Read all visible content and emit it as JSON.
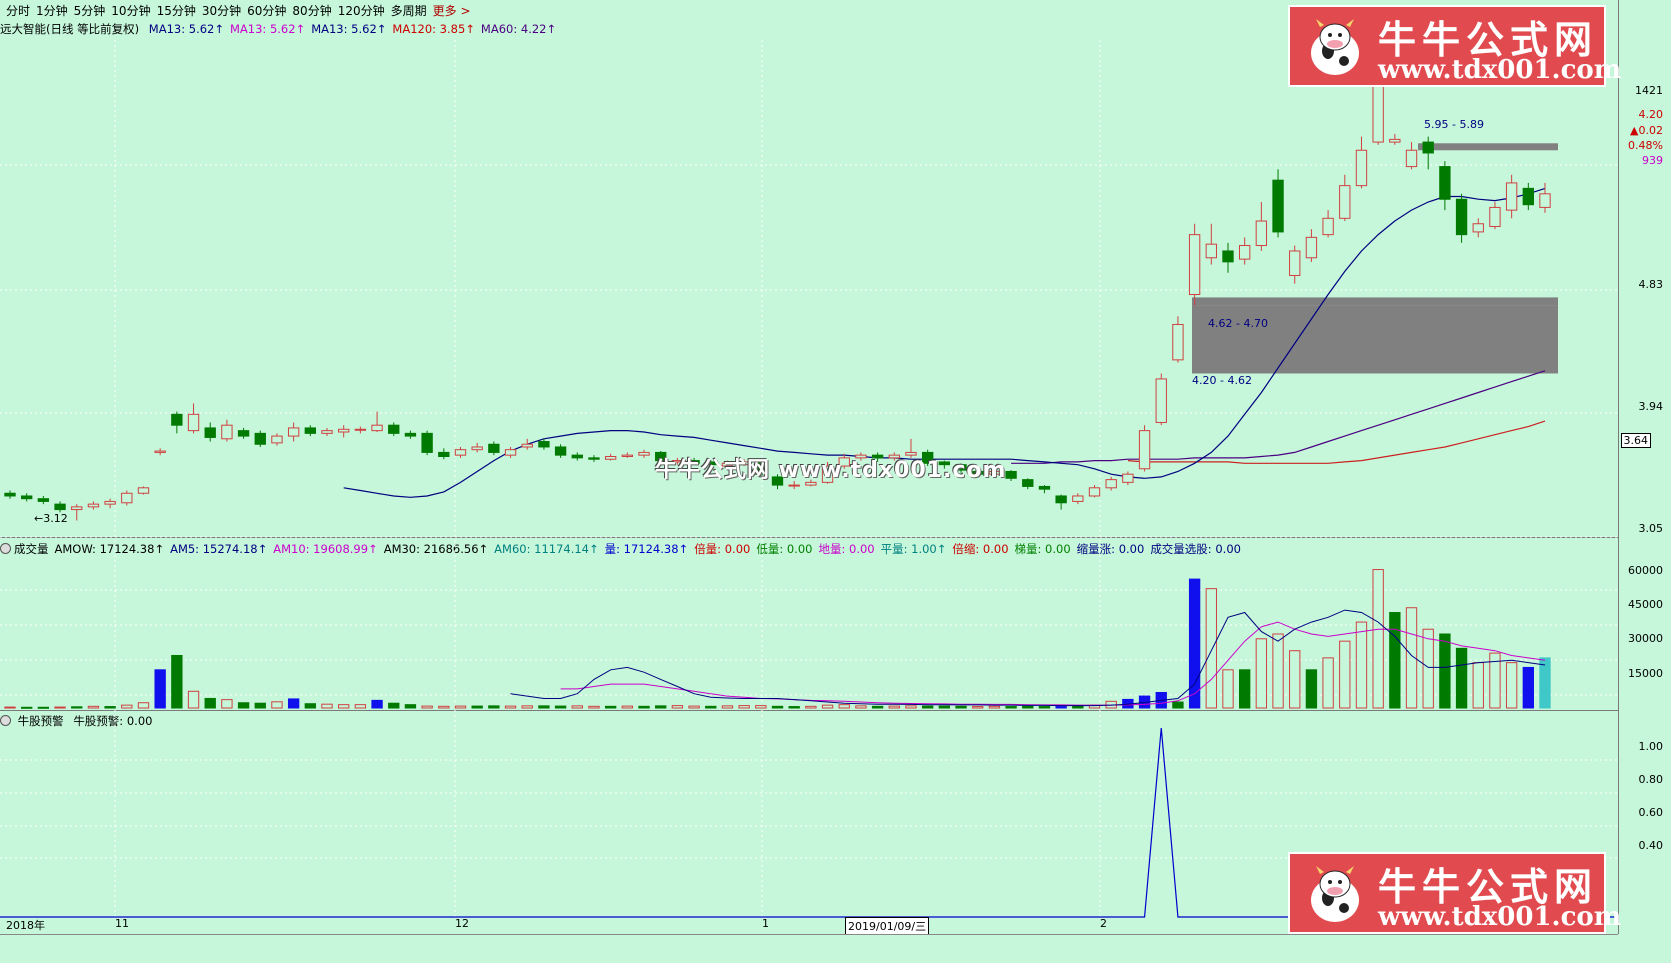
{
  "tabs": [
    "分时",
    "1分钟",
    "5分钟",
    "10分钟",
    "15分钟",
    "30分钟",
    "60分钟",
    "80分钟",
    "120分钟",
    "多周期",
    "更多 >"
  ],
  "main_legend": {
    "title": "远大智能(日线 等比前复权)",
    "items": [
      {
        "text": "MA13: 5.62↑",
        "color": "#000080"
      },
      {
        "text": "MA13: 5.62↑",
        "color": "#cc00cc"
      },
      {
        "text": "MA13: 5.62↑",
        "color": "#000080"
      },
      {
        "text": "MA120: 3.85↑",
        "color": "#cc0000"
      },
      {
        "text": "MA60: 4.22↑",
        "color": "#4b0082"
      }
    ]
  },
  "volume_legend": {
    "items": [
      {
        "text": "成交量",
        "color": "#000000"
      },
      {
        "text": "AMOW: 17124.38↑",
        "color": "#000000"
      },
      {
        "text": "AM5: 15274.18↑",
        "color": "#000080"
      },
      {
        "text": "AM10: 19608.99↑",
        "color": "#cc00cc"
      },
      {
        "text": "AM30: 21686.56↑",
        "color": "#000000"
      },
      {
        "text": "AM60: 11174.14↑",
        "color": "#008080"
      },
      {
        "text": "量: 17124.38↑",
        "color": "#0000cc"
      },
      {
        "text": "倍量: 0.00",
        "color": "#cc0000"
      },
      {
        "text": "低量: 0.00",
        "color": "#008000"
      },
      {
        "text": "地量: 0.00",
        "color": "#cc00cc"
      },
      {
        "text": "平量: 1.00↑",
        "color": "#008080"
      },
      {
        "text": "倍缩: 0.00",
        "color": "#cc0000"
      },
      {
        "text": "梯量: 0.00",
        "color": "#008000"
      },
      {
        "text": "缩量涨: 0.00",
        "color": "#000080"
      },
      {
        "text": "成交量选股: 0.00",
        "color": "#000080"
      }
    ]
  },
  "indicator_legend": {
    "title": "牛股预警",
    "value": "牛股预警: 0.00"
  },
  "price_axis": [
    "1421",
    "4.20",
    "▲0.02",
    "0.48%",
    "939",
    "4.83",
    "3.94",
    "3.64",
    "3.05"
  ],
  "volume_axis": [
    "60000",
    "45000",
    "30000",
    "15000"
  ],
  "indicator_axis": [
    "1.00",
    "0.80",
    "0.60",
    "0.40"
  ],
  "annotations": {
    "low_label": "←3.12",
    "zone_label_1": "4.62 - 4.70",
    "zone_label_2": "4.20 - 4.62",
    "high_zone_label": "5.95 - 5.89"
  },
  "date_labels": [
    "2018年",
    "11",
    "12",
    "1",
    "2019/01/09/三",
    "2"
  ],
  "watermark": {
    "logo_text": "牛牛公式网",
    "logo_url": "www.tdx001.com",
    "center_text": "牛牛公式网 www.tdx001.com"
  },
  "colors": {
    "background": "#c6f7da",
    "up": "#d04040",
    "down": "#007a00",
    "ma_dark": "#000080",
    "ma60": "#4b0082",
    "ma120": "#cc2020"
  },
  "chart_data": {
    "type": "candlestick",
    "candles": [
      [
        3.32,
        3.3,
        3.34,
        3.28
      ],
      [
        3.3,
        3.28,
        3.32,
        3.26
      ],
      [
        3.28,
        3.26,
        3.3,
        3.24
      ],
      [
        3.24,
        3.2,
        3.26,
        3.18
      ],
      [
        3.2,
        3.22,
        3.24,
        3.12
      ],
      [
        3.22,
        3.24,
        3.26,
        3.2
      ],
      [
        3.24,
        3.26,
        3.28,
        3.21
      ],
      [
        3.25,
        3.32,
        3.34,
        3.23
      ],
      [
        3.32,
        3.36,
        3.37,
        3.31
      ],
      [
        3.62,
        3.63,
        3.65,
        3.6
      ],
      [
        3.9,
        3.82,
        3.92,
        3.76
      ],
      [
        3.78,
        3.9,
        3.98,
        3.76
      ],
      [
        3.8,
        3.73,
        3.84,
        3.7
      ],
      [
        3.72,
        3.82,
        3.86,
        3.7
      ],
      [
        3.78,
        3.74,
        3.8,
        3.72
      ],
      [
        3.76,
        3.68,
        3.78,
        3.66
      ],
      [
        3.69,
        3.74,
        3.76,
        3.67
      ],
      [
        3.74,
        3.8,
        3.84,
        3.7
      ],
      [
        3.8,
        3.76,
        3.82,
        3.74
      ],
      [
        3.76,
        3.78,
        3.8,
        3.74
      ],
      [
        3.77,
        3.79,
        3.82,
        3.73
      ],
      [
        3.79,
        3.79,
        3.81,
        3.76
      ],
      [
        3.78,
        3.82,
        3.92,
        3.77
      ],
      [
        3.82,
        3.76,
        3.84,
        3.74
      ],
      [
        3.76,
        3.74,
        3.78,
        3.72
      ],
      [
        3.76,
        3.62,
        3.78,
        3.6
      ],
      [
        3.62,
        3.59,
        3.65,
        3.57
      ],
      [
        3.6,
        3.64,
        3.66,
        3.58
      ],
      [
        3.64,
        3.66,
        3.69,
        3.62
      ],
      [
        3.68,
        3.62,
        3.7,
        3.6
      ],
      [
        3.6,
        3.64,
        3.66,
        3.58
      ],
      [
        3.66,
        3.68,
        3.72,
        3.64
      ],
      [
        3.7,
        3.66,
        3.72,
        3.64
      ],
      [
        3.66,
        3.6,
        3.68,
        3.58
      ],
      [
        3.6,
        3.58,
        3.62,
        3.56
      ],
      [
        3.58,
        3.57,
        3.6,
        3.55
      ],
      [
        3.57,
        3.59,
        3.61,
        3.56
      ],
      [
        3.59,
        3.6,
        3.62,
        3.58
      ],
      [
        3.6,
        3.62,
        3.64,
        3.58
      ],
      [
        3.62,
        3.56,
        3.63,
        3.53
      ],
      [
        3.55,
        3.56,
        3.58,
        3.53
      ],
      [
        3.56,
        3.54,
        3.58,
        3.53
      ],
      [
        3.55,
        3.53,
        3.56,
        3.5
      ],
      [
        3.52,
        3.54,
        3.56,
        3.51
      ],
      [
        3.53,
        3.55,
        3.57,
        3.52
      ],
      [
        3.55,
        3.46,
        3.56,
        3.44
      ],
      [
        3.44,
        3.38,
        3.46,
        3.35
      ],
      [
        3.38,
        3.38,
        3.41,
        3.35
      ],
      [
        3.38,
        3.4,
        3.42,
        3.37
      ],
      [
        3.4,
        3.52,
        3.55,
        3.39
      ],
      [
        3.52,
        3.58,
        3.61,
        3.5
      ],
      [
        3.58,
        3.6,
        3.62,
        3.56
      ],
      [
        3.6,
        3.58,
        3.62,
        3.55
      ],
      [
        3.58,
        3.6,
        3.62,
        3.56
      ],
      [
        3.6,
        3.62,
        3.72,
        3.58
      ],
      [
        3.62,
        3.54,
        3.64,
        3.52
      ],
      [
        3.55,
        3.53,
        3.56,
        3.5
      ],
      [
        3.53,
        3.49,
        3.54,
        3.47
      ],
      [
        3.48,
        3.46,
        3.5,
        3.45
      ],
      [
        3.46,
        3.48,
        3.5,
        3.45
      ],
      [
        3.48,
        3.43,
        3.49,
        3.41
      ],
      [
        3.42,
        3.37,
        3.43,
        3.35
      ],
      [
        3.37,
        3.35,
        3.38,
        3.32
      ],
      [
        3.3,
        3.25,
        3.31,
        3.2
      ],
      [
        3.26,
        3.3,
        3.32,
        3.24
      ],
      [
        3.3,
        3.36,
        3.38,
        3.29
      ],
      [
        3.36,
        3.42,
        3.44,
        3.34
      ],
      [
        3.4,
        3.46,
        3.48,
        3.38
      ],
      [
        3.5,
        3.78,
        3.82,
        3.48
      ],
      [
        3.84,
        4.16,
        4.2,
        3.82
      ],
      [
        4.3,
        4.56,
        4.62,
        4.28
      ],
      [
        4.78,
        5.22,
        5.3,
        4.7
      ],
      [
        5.05,
        5.15,
        5.3,
        5.0
      ],
      [
        5.1,
        5.02,
        5.16,
        4.94
      ],
      [
        5.04,
        5.14,
        5.2,
        5.0
      ],
      [
        5.14,
        5.32,
        5.46,
        5.1
      ],
      [
        5.62,
        5.24,
        5.7,
        5.2
      ],
      [
        4.92,
        5.1,
        5.14,
        4.86
      ],
      [
        5.05,
        5.2,
        5.26,
        5.02
      ],
      [
        5.22,
        5.34,
        5.4,
        5.2
      ],
      [
        5.34,
        5.58,
        5.66,
        5.32
      ],
      [
        5.58,
        5.84,
        5.94,
        5.56
      ],
      [
        5.9,
        6.5,
        6.6,
        5.88
      ],
      [
        5.9,
        5.92,
        5.96,
        5.88
      ],
      [
        5.72,
        5.84,
        5.9,
        5.7
      ],
      [
        5.9,
        5.82,
        5.94,
        5.7
      ],
      [
        5.72,
        5.48,
        5.76,
        5.4
      ],
      [
        5.48,
        5.22,
        5.52,
        5.16
      ],
      [
        5.24,
        5.3,
        5.34,
        5.2
      ],
      [
        5.28,
        5.42,
        5.46,
        5.26
      ],
      [
        5.4,
        5.6,
        5.66,
        5.34
      ],
      [
        5.56,
        5.44,
        5.6,
        5.4
      ],
      [
        5.42,
        5.52,
        5.6,
        5.38
      ]
    ],
    "ma13": [
      3.36,
      3.34,
      3.32,
      3.3,
      3.29,
      3.3,
      3.33,
      3.4,
      3.48,
      3.56,
      3.63,
      3.68,
      3.72,
      3.74,
      3.76,
      3.77,
      3.78,
      3.78,
      3.77,
      3.75,
      3.74,
      3.73,
      3.71,
      3.69,
      3.67,
      3.65,
      3.63,
      3.62,
      3.61,
      3.6,
      3.6,
      3.59,
      3.58,
      3.58,
      3.57,
      3.57,
      3.57,
      3.57,
      3.57,
      3.57,
      3.57,
      3.56,
      3.55,
      3.54,
      3.53,
      3.5,
      3.46,
      3.44,
      3.43,
      3.44,
      3.48,
      3.54,
      3.62,
      3.74,
      3.9,
      4.06,
      4.24,
      4.42,
      4.6,
      4.78,
      4.95,
      5.1,
      5.22,
      5.32,
      5.4,
      5.46,
      5.5,
      5.5,
      5.48,
      5.47,
      5.49,
      5.52,
      5.56
    ],
    "ma60": [
      3.54,
      3.54,
      3.54,
      3.55,
      3.55,
      3.56,
      3.56,
      3.57,
      3.57,
      3.57,
      3.57,
      3.58,
      3.58,
      3.58,
      3.58,
      3.59,
      3.6,
      3.62,
      3.66,
      3.7,
      3.74,
      3.78,
      3.82,
      3.86,
      3.9,
      3.94,
      3.98,
      4.02,
      4.06,
      4.1,
      4.14,
      4.18,
      4.22
    ],
    "ma120": [
      3.56,
      3.55,
      3.55,
      3.55,
      3.55,
      3.55,
      3.55,
      3.54,
      3.54,
      3.54,
      3.54,
      3.54,
      3.54,
      3.55,
      3.56,
      3.58,
      3.6,
      3.62,
      3.64,
      3.66,
      3.69,
      3.72,
      3.75,
      3.78,
      3.81,
      3.85
    ],
    "volumes": [
      400,
      300,
      300,
      400,
      500,
      700,
      600,
      1200,
      2200,
      16000,
      22000,
      7000,
      4000,
      3500,
      2200,
      2000,
      2600,
      3800,
      1800,
      1600,
      1400,
      1400,
      3200,
      2000,
      1400,
      800,
      700,
      800,
      800,
      900,
      800,
      900,
      900,
      800,
      900,
      700,
      700,
      800,
      700,
      900,
      1000,
      800,
      700,
      900,
      1000,
      1000,
      700,
      600,
      700,
      1200,
      1400,
      900,
      700,
      800,
      900,
      800,
      800,
      700,
      600,
      700,
      600,
      700,
      600,
      600,
      800,
      1200,
      2800,
      3600,
      5000,
      6500,
      2500,
      54000,
      50000,
      16000,
      16000,
      29000,
      31000,
      24000,
      16000,
      21000,
      28000,
      36000,
      58000,
      40000,
      42000,
      33000,
      31000,
      25000,
      19000,
      23000,
      19000,
      17000,
      21000
    ],
    "volume_colors": [
      "up",
      "down",
      "down",
      "up",
      "down",
      "up",
      "down",
      "up",
      "up",
      "blue",
      "down",
      "up",
      "down",
      "up",
      "down",
      "down",
      "up",
      "blue",
      "down",
      "up",
      "up",
      "up",
      "blue",
      "down",
      "down",
      "up",
      "up",
      "up",
      "down",
      "down",
      "up",
      "up",
      "down",
      "down",
      "up",
      "up",
      "down",
      "up",
      "down",
      "down",
      "up",
      "up",
      "down",
      "up",
      "up",
      "up",
      "down",
      "down",
      "up",
      "up",
      "up",
      "up",
      "down",
      "up",
      "up",
      "down",
      "down",
      "down",
      "up",
      "up",
      "down",
      "down",
      "down",
      "blue",
      "down",
      "up",
      "up",
      "blue",
      "blue",
      "blue",
      "down",
      "blue",
      "up",
      "up",
      "down",
      "up",
      "up",
      "up",
      "down",
      "up",
      "up",
      "up",
      "up",
      "down",
      "up",
      "up",
      "down",
      "down",
      "up",
      "up",
      "up",
      "blue",
      "cyan"
    ],
    "am5": [
      6.0,
      5.0,
      4.0,
      4.0,
      6.0,
      12.0,
      16.0,
      17.0,
      15.0,
      12.0,
      9.0,
      6.0,
      4.5,
      4.2,
      4.0,
      4.0,
      4.0,
      3.5,
      3.0,
      2.5,
      2.0,
      1.8,
      1.6,
      1.6,
      1.5,
      1.4,
      1.4,
      1.3,
      1.3,
      1.2,
      1.2,
      1.1,
      1.1,
      1.0,
      1.0,
      1.0,
      1.2,
      1.6,
      2.3,
      3.2,
      4.0,
      10.0,
      24.0,
      38.0,
      40.0,
      32.0,
      28.0,
      33.0,
      36.0,
      38.0,
      41.0,
      40.0,
      36.0,
      30.0,
      22.0,
      17.0,
      17.0,
      18.0,
      19.0,
      19.5,
      20.0,
      19.0,
      18.0
    ],
    "am10": [
      8.0,
      8.0,
      9.0,
      10.0,
      10.0,
      10.0,
      9.0,
      8.0,
      7.0,
      6.0,
      5.0,
      4.5,
      4.0,
      3.8,
      3.5,
      3.2,
      3.0,
      2.8,
      2.5,
      2.2,
      2.0,
      1.9,
      1.8,
      1.7,
      1.6,
      1.6,
      1.5,
      1.5,
      1.4,
      1.3,
      1.3,
      1.2,
      1.2,
      1.2,
      1.3,
      1.5,
      2.0,
      3.0,
      6.0,
      12.0,
      20.0,
      28.0,
      34.0,
      36.0,
      33.0,
      31.0,
      30.0,
      31.0,
      32.0,
      33.0,
      33.0,
      31.0,
      29.0,
      28.0,
      26.0,
      25.0,
      24.0,
      22.0,
      21.0,
      20.0
    ],
    "indicator": {
      "spike_at_index": 69,
      "values_range": [
        0,
        1
      ]
    }
  }
}
